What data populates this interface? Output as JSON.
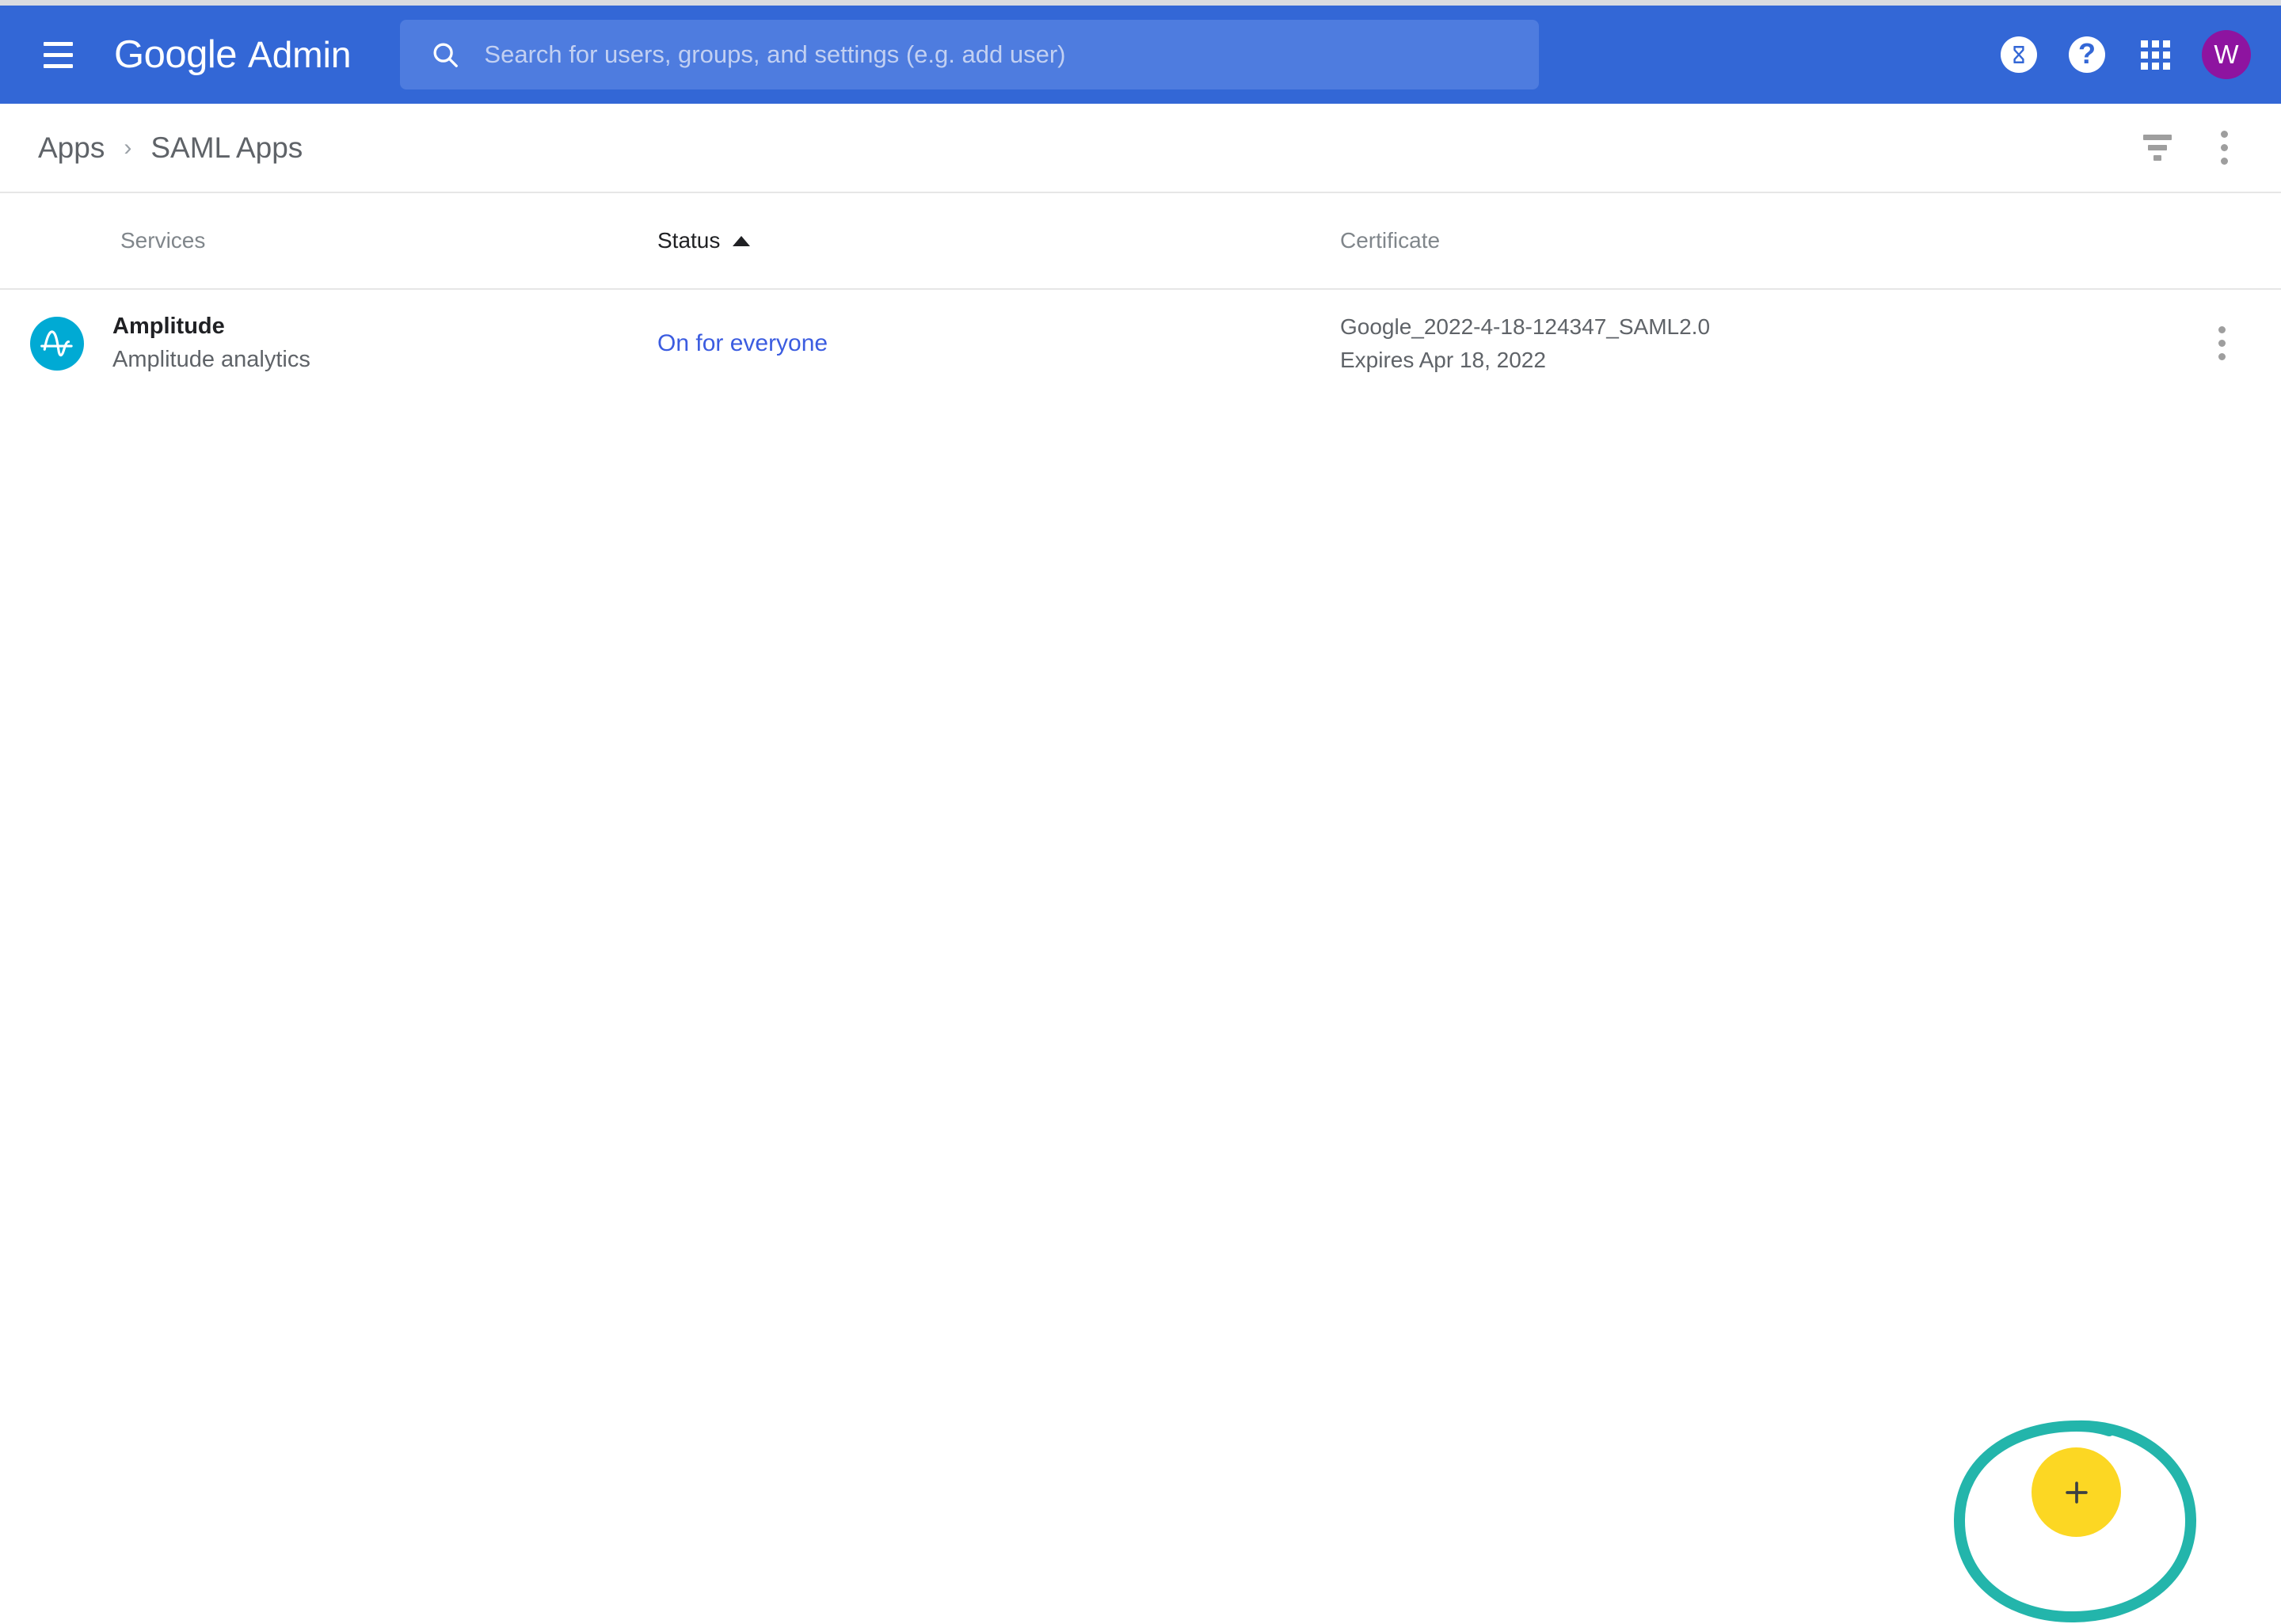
{
  "appbar": {
    "menu_icon": "hamburger-menu-icon",
    "brand_google": "Google",
    "brand_product": "Admin",
    "search": {
      "icon": "search-icon",
      "placeholder": "Search for users, groups, and settings (e.g. add user)",
      "value": ""
    },
    "trial_icon": "hourglass-icon",
    "help_icon": "help-question-icon",
    "help_glyph": "?",
    "apps_icon": "apps-grid-icon",
    "avatar_initial": "W",
    "avatar_color": "#8e14a0",
    "background_color": "#3367d6"
  },
  "breadcrumb": {
    "parent": "Apps",
    "separator": "›",
    "current": "SAML Apps",
    "filter_icon": "filter-icon",
    "more_icon": "more-vertical-icon"
  },
  "table": {
    "columns": [
      {
        "key": "services",
        "label": "Services",
        "sorted": false
      },
      {
        "key": "status",
        "label": "Status",
        "sorted": true,
        "sort_direction": "asc"
      },
      {
        "key": "certificate",
        "label": "Certificate",
        "sorted": false
      }
    ],
    "rows": [
      {
        "app_name": "Amplitude",
        "app_description": "Amplitude analytics",
        "app_logo": "amplitude-logo-icon",
        "app_logo_color": "#00aad4",
        "status": "On for everyone",
        "status_color": "#3b5ce0",
        "certificate_name": "Google_2022-4-18-124347_SAML2.0",
        "certificate_expiry": "Expires Apr 18, 2022",
        "row_menu_icon": "more-vertical-icon"
      }
    ]
  },
  "fab": {
    "icon": "plus-icon",
    "label": "+",
    "color": "#fcd723",
    "annotation_color": "#23b5ab",
    "annotation": "highlight-ellipse"
  }
}
